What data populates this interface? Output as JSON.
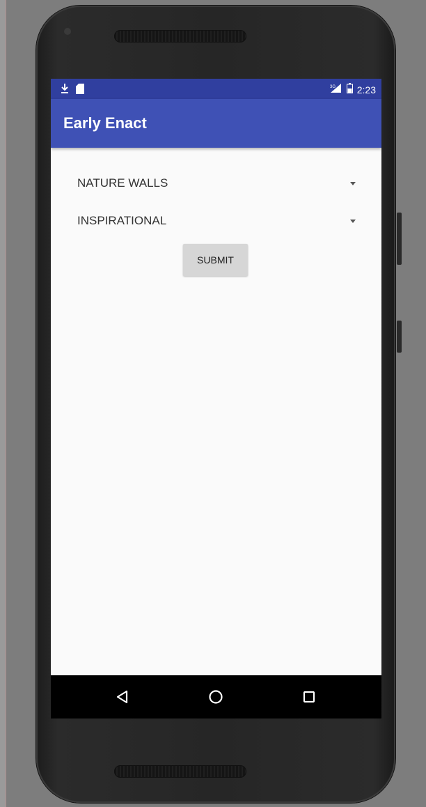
{
  "status_bar": {
    "time": "2:23",
    "left_icons": [
      "download-icon",
      "sd-card-icon"
    ],
    "right_icons": [
      "signal-icon",
      "battery-icon"
    ]
  },
  "app_bar": {
    "title": "Early Enact",
    "color": "#3f51b5",
    "status_color": "#303f9f"
  },
  "form": {
    "spinners": [
      {
        "selected": "NATURE WALLS"
      },
      {
        "selected": "INSPIRATIONAL"
      }
    ],
    "submit_label": "SUBMIT"
  },
  "nav_bar": {
    "buttons": [
      "back-icon",
      "home-icon",
      "recents-icon"
    ]
  }
}
